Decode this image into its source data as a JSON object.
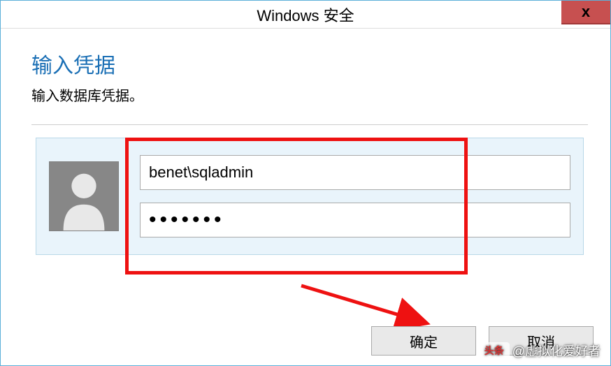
{
  "window": {
    "title": "Windows 安全",
    "close_label": "x"
  },
  "dialog": {
    "heading": "输入凭据",
    "subheading": "输入数据库凭据。"
  },
  "credentials": {
    "username_value": "benet\\sqladmin",
    "password_value": "•••••••"
  },
  "buttons": {
    "ok": "确定",
    "cancel": "取消"
  },
  "watermark": {
    "badge": "头条",
    "text": "@虚拟化爱好者"
  },
  "icons": {
    "avatar": "user-silhouette-icon",
    "close": "close-icon"
  }
}
